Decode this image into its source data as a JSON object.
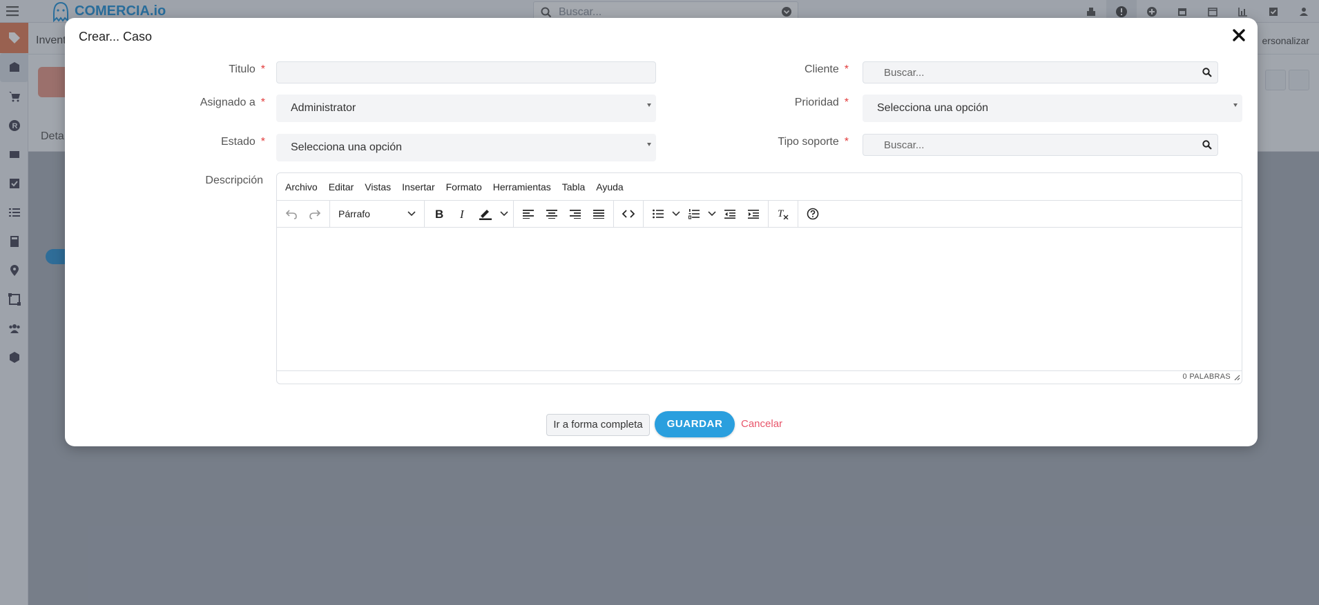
{
  "app": {
    "brand": "COMERCIA.io",
    "search_placeholder": "Buscar...",
    "breadcrumb": "Invent",
    "personalize": "ersonalizar",
    "detail_tab": "Deta"
  },
  "modal": {
    "title": "Crear... Caso",
    "fields": {
      "titulo_label": "Titulo",
      "titulo_value": "",
      "asignado_label": "Asignado a",
      "asignado_value": "Administrator",
      "estado_label": "Estado",
      "estado_value": "Selecciona una opción",
      "descripcion_label": "Descripción",
      "cliente_label": "Cliente",
      "cliente_placeholder": "Buscar...",
      "prioridad_label": "Prioridad",
      "prioridad_value": "Selecciona una opción",
      "tipo_label": "Tipo soporte",
      "tipo_placeholder": "Buscar...",
      "required_mark": "*"
    },
    "editor": {
      "menus": [
        "Archivo",
        "Editar",
        "Vistas",
        "Insertar",
        "Formato",
        "Herramientas",
        "Tabla",
        "Ayuda"
      ],
      "block_format": "Párrafo",
      "word_count": "0 PALABRAS"
    },
    "buttons": {
      "full_form": "Ir a forma completa",
      "save": "GUARDAR",
      "cancel": "Cancelar"
    }
  },
  "colors": {
    "accent": "#2a9fde",
    "required": "#e23b3b",
    "cancel": "#e8556a",
    "brand": "#1f8fd6"
  }
}
